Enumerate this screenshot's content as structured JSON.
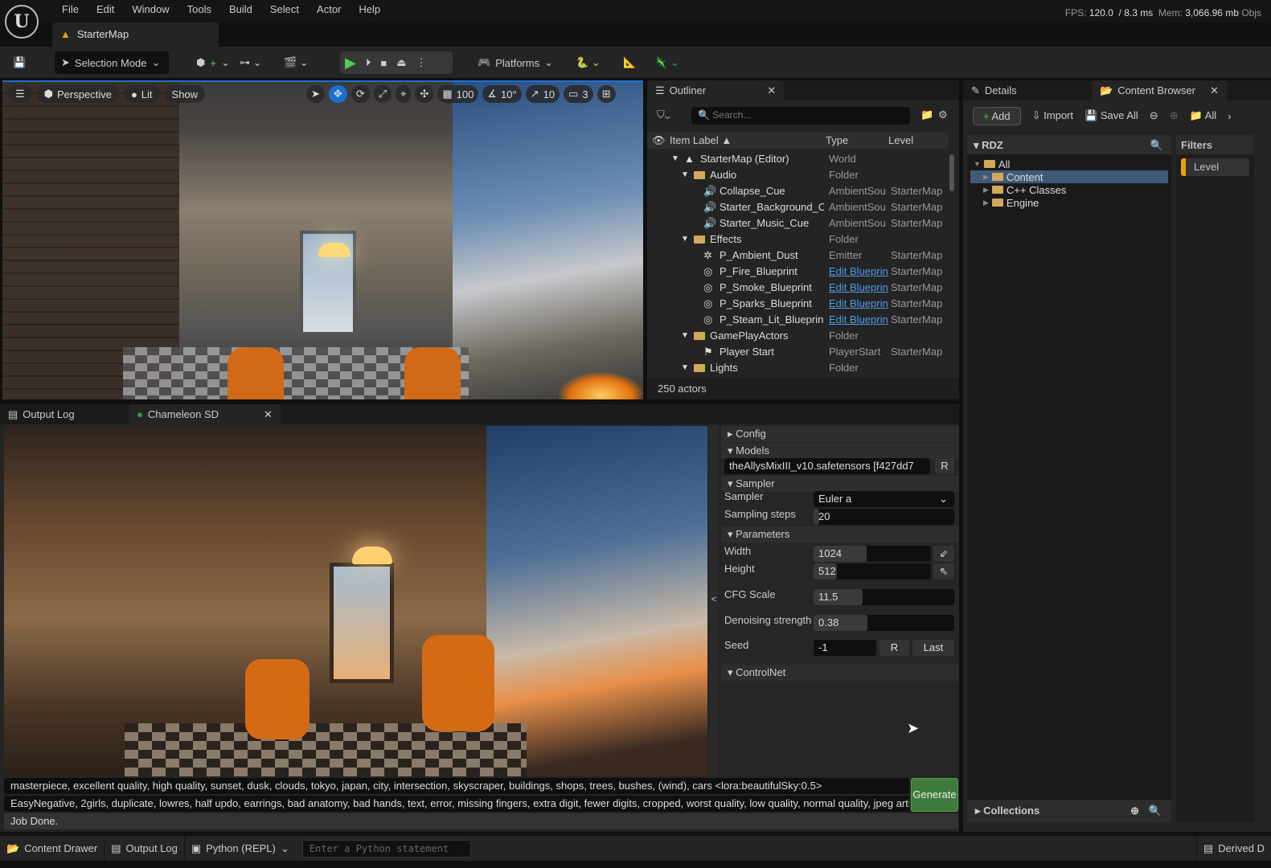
{
  "menu": [
    "File",
    "Edit",
    "Window",
    "Tools",
    "Build",
    "Select",
    "Actor",
    "Help"
  ],
  "stats": {
    "fps_label": "FPS:",
    "fps": "120.0",
    "ms": "/ 8.3 ms",
    "mem_label": "Mem:",
    "mem": "3,066.96 mb",
    "objs": "Objs"
  },
  "map_tab": "StarterMap",
  "toolbar": {
    "selection_mode": "Selection Mode",
    "platforms": "Platforms"
  },
  "viewport": {
    "perspective": "Perspective",
    "lit": "Lit",
    "show": "Show",
    "grid": "100",
    "angle": "10°",
    "scale": "10",
    "camera": "3"
  },
  "outliner": {
    "title": "Outliner",
    "search_placeholder": "Search...",
    "columns": [
      "Item Label ▲",
      "Type",
      "Level"
    ],
    "footer": "250 actors",
    "rows": [
      {
        "indent": 0,
        "icon": "▲",
        "label": "StarterMap (Editor)",
        "type": "World",
        "level": "",
        "link": false,
        "arrow": "▼"
      },
      {
        "indent": 1,
        "icon": "folder",
        "label": "Audio",
        "type": "Folder",
        "level": "",
        "link": false,
        "arrow": "▼"
      },
      {
        "indent": 2,
        "icon": "🔊",
        "label": "Collapse_Cue",
        "type": "AmbientSou",
        "level": "StarterMap",
        "link": false
      },
      {
        "indent": 2,
        "icon": "🔊",
        "label": "Starter_Background_C",
        "type": "AmbientSou",
        "level": "StarterMap",
        "link": false
      },
      {
        "indent": 2,
        "icon": "🔊",
        "label": "Starter_Music_Cue",
        "type": "AmbientSou",
        "level": "StarterMap",
        "link": false
      },
      {
        "indent": 1,
        "icon": "folder",
        "label": "Effects",
        "type": "Folder",
        "level": "",
        "link": false,
        "arrow": "▼"
      },
      {
        "indent": 2,
        "icon": "✲",
        "label": "P_Ambient_Dust",
        "type": "Emitter",
        "level": "StarterMap",
        "link": false
      },
      {
        "indent": 2,
        "icon": "◎",
        "label": "P_Fire_Blueprint",
        "type": "Edit Blueprint",
        "level": "StarterMap",
        "link": true
      },
      {
        "indent": 2,
        "icon": "◎",
        "label": "P_Smoke_Blueprint",
        "type": "Edit Blueprint",
        "level": "StarterMap",
        "link": true
      },
      {
        "indent": 2,
        "icon": "◎",
        "label": "P_Sparks_Blueprint",
        "type": "Edit Blueprint",
        "level": "StarterMap",
        "link": true
      },
      {
        "indent": 2,
        "icon": "◎",
        "label": "P_Steam_Lit_Blueprint",
        "type": "Edit Blueprint",
        "level": "StarterMap",
        "link": true
      },
      {
        "indent": 1,
        "icon": "folder",
        "label": "GamePlayActors",
        "type": "Folder",
        "level": "",
        "link": false,
        "arrow": "▼"
      },
      {
        "indent": 2,
        "icon": "⚑",
        "label": "Player Start",
        "type": "PlayerStart",
        "level": "StarterMap",
        "link": false
      },
      {
        "indent": 1,
        "icon": "folder",
        "label": "Lights",
        "type": "Folder",
        "level": "",
        "link": false,
        "arrow": "▼"
      }
    ]
  },
  "right": {
    "details_tab": "Details",
    "cb_tab": "Content Browser",
    "add": "Add",
    "import": "Import",
    "save_all": "Save All",
    "path": "All",
    "rdz": "RDZ",
    "tree": [
      {
        "label": "All",
        "indent": 0,
        "arrow": "▼",
        "sel": false
      },
      {
        "label": "Content",
        "indent": 1,
        "arrow": "▶",
        "sel": true
      },
      {
        "label": "C++ Classes",
        "indent": 1,
        "arrow": "▶",
        "sel": false
      },
      {
        "label": "Engine",
        "indent": 1,
        "arrow": "▶",
        "sel": false
      }
    ],
    "filters": "Filters",
    "filter_level": "Level",
    "collections": "Collections"
  },
  "bottom": {
    "output_log_tab": "Output Log",
    "chameleon_tab": "Chameleon SD",
    "config": "Config",
    "models": "Models",
    "model_value": "theAllysMixIII_v10.safetensors [f427dd7",
    "refresh": "R",
    "sampler_section": "Sampler",
    "sampler_label": "Sampler",
    "sampler_value": "Euler a",
    "steps_label": "Sampling steps",
    "steps": "20",
    "parameters": "Parameters",
    "width_label": "Width",
    "width": "1024",
    "height_label": "Height",
    "height": "512",
    "cfg_label": "CFG Scale",
    "cfg": "11.5",
    "denoise_label": "Denoising strength",
    "denoise": "0.38",
    "seed_label": "Seed",
    "seed": "-1",
    "seed_r": "R",
    "seed_last": "Last",
    "controlnet": "ControlNet",
    "prompt": "masterpiece, excellent quality, high quality, sunset, dusk, clouds, tokyo, japan, city, intersection, skyscraper, buildings, shops, trees, bushes, (wind), cars <lora:beautifulSky:0.5>",
    "negative": "EasyNegative, 2girls, duplicate, lowres, half updo, earrings, bad anatomy, bad hands, text, error, missing fingers, extra digit, fewer digits, cropped, worst quality, low quality, normal quality, jpeg artif",
    "generate": "Generate",
    "status": "Job Done.",
    "slider_fill": {
      "steps": 0.04,
      "width": 0.45,
      "height": 0.2,
      "cfg": 0.35,
      "denoise": 0.38
    }
  },
  "statusbar": {
    "content_drawer": "Content Drawer",
    "output_log": "Output Log",
    "python": "Python (REPL)",
    "python_placeholder": "Enter a Python statement",
    "derived": "Derived D"
  },
  "colors": {
    "accent": "#1b70d4",
    "generate": "#3e7a3a",
    "link": "#4f9ae8",
    "filter": "#f0a000"
  }
}
